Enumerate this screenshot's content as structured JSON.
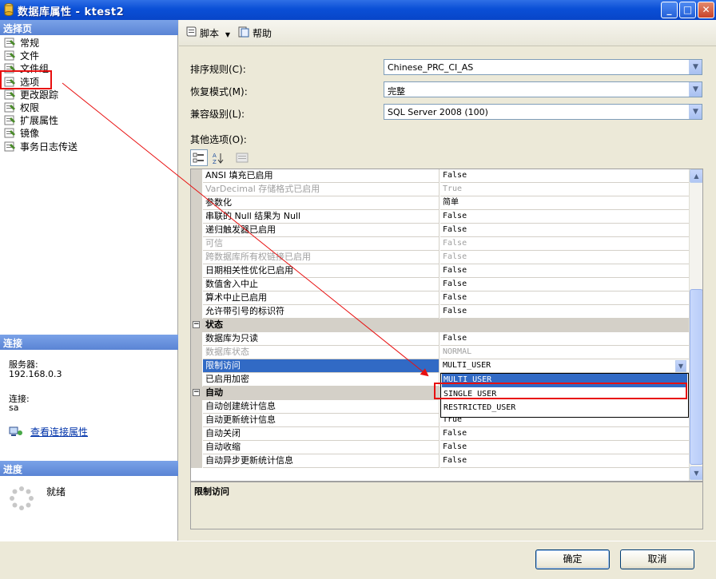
{
  "window": {
    "title": "数据库属性 - ktest2",
    "minimize": "_",
    "maximize": "□",
    "close": "✕"
  },
  "left": {
    "select_page_header": "选择页",
    "pages": [
      {
        "label": "常规"
      },
      {
        "label": "文件"
      },
      {
        "label": "文件组"
      },
      {
        "label": "选项"
      },
      {
        "label": "更改跟踪"
      },
      {
        "label": "权限"
      },
      {
        "label": "扩展属性"
      },
      {
        "label": "镜像"
      },
      {
        "label": "事务日志传送"
      }
    ],
    "connection_header": "连接",
    "server_label": "服务器:",
    "server_value": "192.168.0.3",
    "connection_label": "连接:",
    "connection_value": "sa",
    "view_connection_props": "查看连接属性",
    "progress_header": "进度",
    "progress_status": "就绪"
  },
  "toolbar": {
    "script_label": "脚本",
    "help_label": "帮助"
  },
  "form": {
    "collation_label": "排序规则(C):",
    "collation_value": "Chinese_PRC_CI_AS",
    "recovery_label": "恢复模式(M):",
    "recovery_value": "完整",
    "compat_label": "兼容级别(L):",
    "compat_value": "SQL Server 2008 (100)",
    "other_options_label": "其他选项(O):"
  },
  "grid": {
    "rows": [
      {
        "name": "ANSI 填充已启用",
        "value": "False"
      },
      {
        "name": "VarDecimal 存储格式已启用",
        "value": "True"
      },
      {
        "name": "参数化",
        "value": "简单"
      },
      {
        "name": "串联的 Null 结果为 Null",
        "value": "False"
      },
      {
        "name": "递归触发器已启用",
        "value": "False"
      },
      {
        "name": "可信",
        "value": "False"
      },
      {
        "name": "跨数据库所有权链接已启用",
        "value": "False"
      },
      {
        "name": "日期相关性优化已启用",
        "value": "False"
      },
      {
        "name": "数值舍入中止",
        "value": "False"
      },
      {
        "name": "算术中止已启用",
        "value": "False"
      },
      {
        "name": "允许带引号的标识符",
        "value": "False"
      },
      {
        "name": "状态",
        "value": ""
      },
      {
        "name": "数据库为只读",
        "value": "False"
      },
      {
        "name": "数据库状态",
        "value": "NORMAL"
      },
      {
        "name": "限制访问",
        "value": "MULTI_USER"
      },
      {
        "name": "已启用加密",
        "value": ""
      },
      {
        "name": "自动",
        "value": ""
      },
      {
        "name": "自动创建统计信息",
        "value": ""
      },
      {
        "name": "自动更新统计信息",
        "value": "True"
      },
      {
        "name": "自动关闭",
        "value": "False"
      },
      {
        "name": "自动收缩",
        "value": "False"
      },
      {
        "name": "自动异步更新统计信息",
        "value": "False"
      }
    ],
    "dropdown_options": [
      "MULTI_USER",
      "SINGLE_USER",
      "RESTRICTED_USER"
    ],
    "description_title": "限制访问"
  },
  "buttons": {
    "ok": "确定",
    "cancel": "取消"
  },
  "colors": {
    "title_bar": "#0a4fd6",
    "selection": "#316ac5",
    "annotation": "#e81010"
  }
}
